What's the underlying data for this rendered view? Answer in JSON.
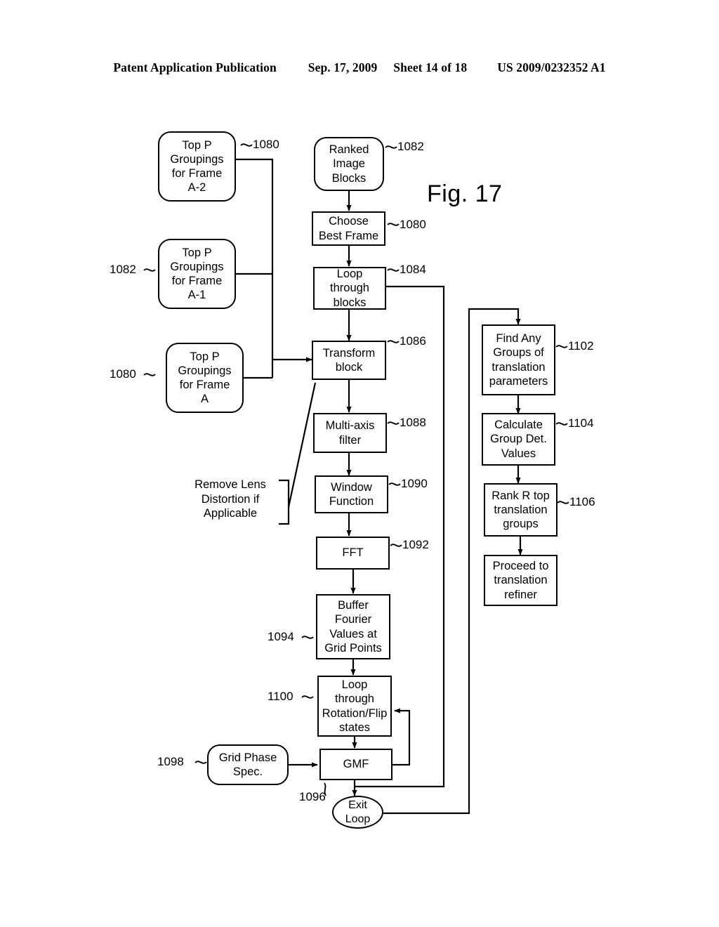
{
  "header": {
    "publication": "Patent Application Publication",
    "date": "Sep. 17, 2009",
    "sheet": "Sheet 14 of 18",
    "number": "US 2009/0232352 A1"
  },
  "figure": {
    "label": "Fig. 17"
  },
  "nodes": {
    "top_p_a2": {
      "label": "Top P Groupings for Frame A-2",
      "ref": "1080"
    },
    "top_p_a1": {
      "label": "Top P Groupings for Frame A-1",
      "ref": "1082"
    },
    "top_p_a": {
      "label": "Top P Groupings for Frame A",
      "ref": "1080"
    },
    "ranked_image_blocks": {
      "label": "Ranked Image Blocks",
      "ref": "1082"
    },
    "choose_best_frame": {
      "label": "Choose Best Frame",
      "ref": "1080"
    },
    "loop_through_blocks": {
      "label": "Loop through blocks",
      "ref": "1084"
    },
    "transform_block": {
      "label": "Transform block",
      "ref": "1086"
    },
    "multi_axis_filter": {
      "label": "Multi-axis filter",
      "ref": "1088"
    },
    "window_function": {
      "label": "Window Function",
      "ref": "1090"
    },
    "fft": {
      "label": "FFT",
      "ref": "1092"
    },
    "buffer_fourier": {
      "label": "Buffer Fourier Values at Grid Points",
      "ref": "1094"
    },
    "loop_rotation_flip": {
      "label": "Loop through Rotation/Flip states",
      "ref": "1100"
    },
    "gmf": {
      "label": "GMF",
      "ref": "1096"
    },
    "exit_loop": {
      "label": "Exit Loop",
      "ref": ""
    },
    "grid_phase_spec": {
      "label": "Grid Phase Spec.",
      "ref": "1098"
    },
    "remove_lens": {
      "label": "Remove Lens Distortion if Applicable",
      "ref": ""
    },
    "find_any_groups": {
      "label": "Find Any Groups of translation parameters",
      "ref": "1102"
    },
    "calculate_group_det": {
      "label": "Calculate Group Det. Values",
      "ref": "1104"
    },
    "rank_r_top": {
      "label": "Rank R top translation groups",
      "ref": "1106"
    },
    "proceed_refiner": {
      "label": "Proceed to translation refiner",
      "ref": ""
    }
  },
  "node_lines": {
    "top_p_a2": [
      "Top P",
      "Groupings",
      "for Frame",
      "A-2"
    ],
    "top_p_a1": [
      "Top P",
      "Groupings",
      "for Frame",
      "A-1"
    ],
    "top_p_a": [
      "Top P",
      "Groupings",
      "for Frame",
      "A"
    ],
    "ranked_image_blocks": [
      "Ranked",
      "Image",
      "Blocks"
    ],
    "choose_best_frame": [
      "Choose",
      "Best Frame"
    ],
    "loop_through_blocks": [
      "Loop",
      "through",
      "blocks"
    ],
    "transform_block": [
      "Transform",
      "block"
    ],
    "multi_axis_filter": [
      "Multi-axis",
      "filter"
    ],
    "window_function": [
      "Window",
      "Function"
    ],
    "fft": [
      "FFT"
    ],
    "buffer_fourier": [
      "Buffer",
      "Fourier",
      "Values at",
      "Grid Points"
    ],
    "loop_rotation_flip": [
      "Loop",
      "through",
      "Rotation/Flip",
      "states"
    ],
    "gmf": [
      "GMF"
    ],
    "exit_loop": [
      "Exit",
      "Loop"
    ],
    "grid_phase_spec": [
      "Grid Phase",
      "Spec."
    ],
    "remove_lens": [
      "Remove Lens",
      "Distortion if",
      "Applicable"
    ],
    "find_any_groups": [
      "Find Any",
      "Groups of",
      "translation",
      "parameters"
    ],
    "calculate_group_det": [
      "Calculate",
      "Group Det.",
      "Values"
    ],
    "rank_r_top": [
      "Rank R top",
      "translation",
      "groups"
    ],
    "proceed_refiner": [
      "Proceed to",
      "translation",
      "refiner"
    ]
  },
  "colors": {
    "ink": "#000000",
    "paper": "#ffffff"
  }
}
